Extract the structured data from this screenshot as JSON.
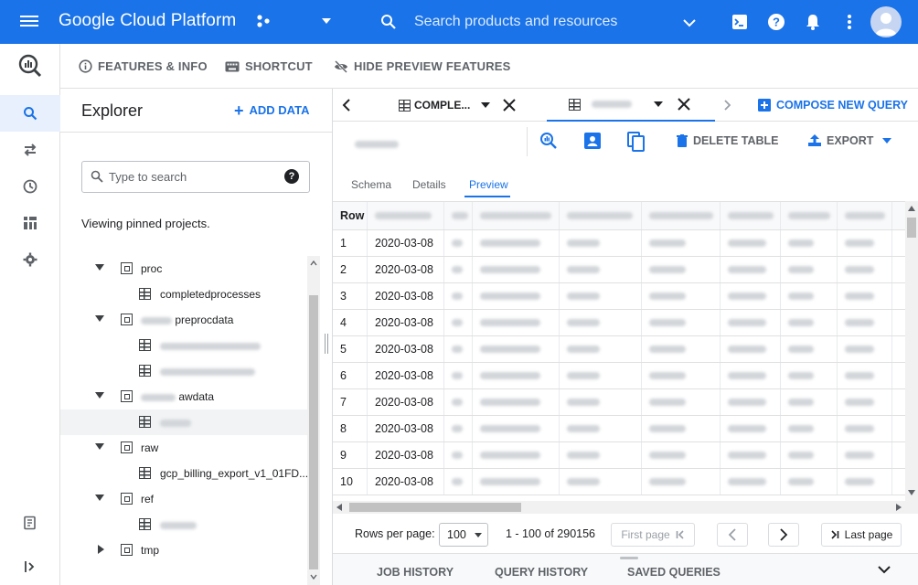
{
  "topbar": {
    "logo_text": "Google Cloud Platform",
    "search_placeholder": "Search products and resources",
    "brand_color": "#1a73e8",
    "icons": [
      "menu-icon",
      "project-selector-icon",
      "search-icon",
      "cloud-shell-icon",
      "help-icon",
      "notifications-icon",
      "more-vert-icon",
      "account-avatar"
    ]
  },
  "leftnav": {
    "items": [
      "search-icon",
      "transfers-icon",
      "history-icon",
      "dashboard-icon",
      "settings-icon",
      "release-notes-icon",
      "collapse-icon"
    ]
  },
  "actionbar": {
    "features_info": "FEATURES & INFO",
    "shortcut": "SHORTCUT",
    "hide_preview": "HIDE PREVIEW FEATURES"
  },
  "explorer": {
    "title": "Explorer",
    "add_data": "ADD DATA",
    "search_placeholder": "Type to search",
    "viewing_text": "Viewing pinned projects.",
    "tree": [
      {
        "type": "dataset",
        "label": "proc",
        "expanded": true
      },
      {
        "type": "table",
        "label": "completedprocesses"
      },
      {
        "type": "dataset",
        "label": "preprocdata",
        "expanded": true
      },
      {
        "type": "table",
        "label": ""
      },
      {
        "type": "table",
        "label": ""
      },
      {
        "type": "dataset",
        "label": "awdata",
        "expanded": true
      },
      {
        "type": "table",
        "label": "",
        "selected": true
      },
      {
        "type": "dataset",
        "label": "raw",
        "expanded": true
      },
      {
        "type": "table",
        "label": "gcp_billing_export_v1_01FD..."
      },
      {
        "type": "dataset",
        "label": "ref",
        "expanded": true
      },
      {
        "type": "table",
        "label": ""
      },
      {
        "type": "dataset",
        "label": "tmp",
        "expanded": false
      }
    ]
  },
  "tabs": {
    "tab1": "COMPLE...",
    "tab2": "",
    "compose": "COMPOSE NEW QUERY"
  },
  "table_toolbar": {
    "table_name": "",
    "delete": "DELETE TABLE",
    "export": "EXPORT"
  },
  "subtabs": {
    "schema": "Schema",
    "details": "Details",
    "preview": "Preview"
  },
  "grid": {
    "header_row": "Row",
    "rows": [
      {
        "n": "1",
        "date": "2020-03-08"
      },
      {
        "n": "2",
        "date": "2020-03-08"
      },
      {
        "n": "3",
        "date": "2020-03-08"
      },
      {
        "n": "4",
        "date": "2020-03-08"
      },
      {
        "n": "5",
        "date": "2020-03-08"
      },
      {
        "n": "6",
        "date": "2020-03-08"
      },
      {
        "n": "7",
        "date": "2020-03-08"
      },
      {
        "n": "8",
        "date": "2020-03-08"
      },
      {
        "n": "9",
        "date": "2020-03-08"
      },
      {
        "n": "10",
        "date": "2020-03-08"
      }
    ]
  },
  "pager": {
    "rows_per_page_label": "Rows per page:",
    "rows_per_page_value": "100",
    "range": "1 - 100 of 290156",
    "first_page": "First page",
    "last_page": "Last page"
  },
  "history": {
    "job_history": "JOB HISTORY",
    "query_history": "QUERY HISTORY",
    "saved_queries": "SAVED QUERIES"
  }
}
